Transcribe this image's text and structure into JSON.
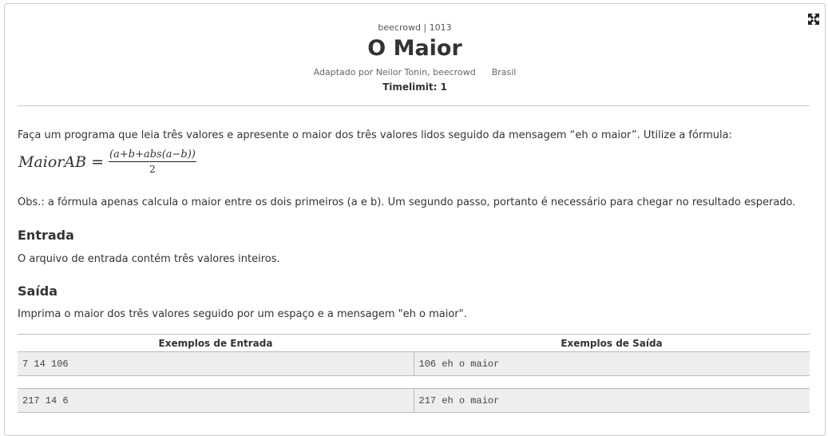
{
  "header": {
    "source": "beecrowd | 1013",
    "title": "O Maior",
    "author": "Adaptado por Neilor Tonin, beecrowd",
    "country": "Brasil",
    "timelimit": "Timelimit: 1"
  },
  "description": {
    "intro": "Faça um programa que leia três valores e apresente o maior dos três valores lidos seguido da mensagem “eh o maior”. Utilize a fórmula:",
    "formula_lhs": "MaiorAB =",
    "formula_num": "(a+b+abs(a−b))",
    "formula_den": "2",
    "obs": "Obs.: a fórmula apenas calcula o maior entre os dois primeiros (a e b). Um segundo passo, portanto é necessário para chegar no resultado esperado."
  },
  "input": {
    "heading": "Entrada",
    "text": "O arquivo de entrada contém três valores inteiros."
  },
  "output": {
    "heading": "Saída",
    "text": "Imprima o maior dos três valores seguido por um espaço e a mensagem \"eh o maior\"."
  },
  "examples": {
    "input_header": "Exemplos de Entrada",
    "output_header": "Exemplos de Saída",
    "rows": [
      {
        "input": "7 14 106",
        "output": "106 eh o maior"
      },
      {
        "input": "217 14 6",
        "output": "217 eh o maior"
      }
    ]
  },
  "icons": {
    "expand": "expand-icon"
  }
}
